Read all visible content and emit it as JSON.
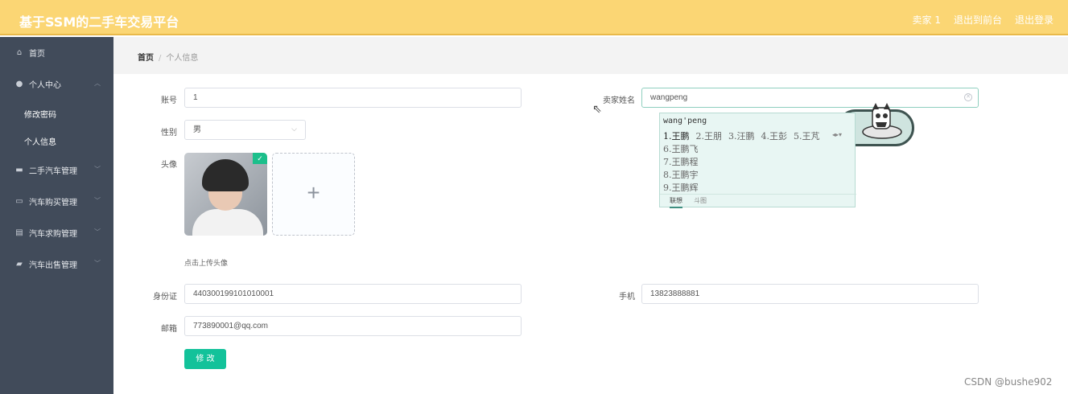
{
  "header": {
    "title": "基于SSM的二手车交易平台",
    "user": "卖家 1",
    "back_to_front": "退出到前台",
    "logout": "退出登录"
  },
  "sidebar": {
    "items": [
      {
        "label": "首页",
        "icon": "home-icon"
      },
      {
        "label": "个人中心",
        "icon": "user-icon",
        "expanded": true,
        "children": [
          {
            "label": "修改密码"
          },
          {
            "label": "个人信息"
          }
        ]
      },
      {
        "label": "二手汽车管理",
        "icon": "car-icon"
      },
      {
        "label": "汽车购买管理",
        "icon": "message-icon"
      },
      {
        "label": "汽车求购管理",
        "icon": "clipboard-icon"
      },
      {
        "label": "汽车出售管理",
        "icon": "briefcase-icon"
      }
    ]
  },
  "breadcrumb": {
    "home": "首页",
    "separator": "/",
    "current": "个人信息"
  },
  "form": {
    "account": {
      "label": "账号",
      "value": "1"
    },
    "seller_name": {
      "label": "卖家姓名",
      "value": "wangpeng"
    },
    "gender": {
      "label": "性别",
      "value": "男"
    },
    "avatar": {
      "label": "头像",
      "tip": "点击上传头像"
    },
    "id_card": {
      "label": "身份证",
      "value": "440300199101010001"
    },
    "phone": {
      "label": "手机",
      "value": "13823888881"
    },
    "email": {
      "label": "邮箱",
      "value": "773890001@qq.com"
    },
    "submit": "修 改"
  },
  "ime": {
    "pinyin": "wang'peng",
    "row1": [
      "1.王鹏",
      "2.王朋",
      "3.汪鹏",
      "4.王彭",
      "5.王芃"
    ],
    "more": [
      "6.王鹏飞",
      "7.王鹏程",
      "8.王鹏宇",
      "9.王鹏辉"
    ],
    "tabs": [
      "联想",
      "斗图"
    ]
  },
  "watermark": "CSDN @bushe902",
  "colors": {
    "header": "#fbd674",
    "sidebar": "#414b5a",
    "accent": "#13c29a"
  }
}
